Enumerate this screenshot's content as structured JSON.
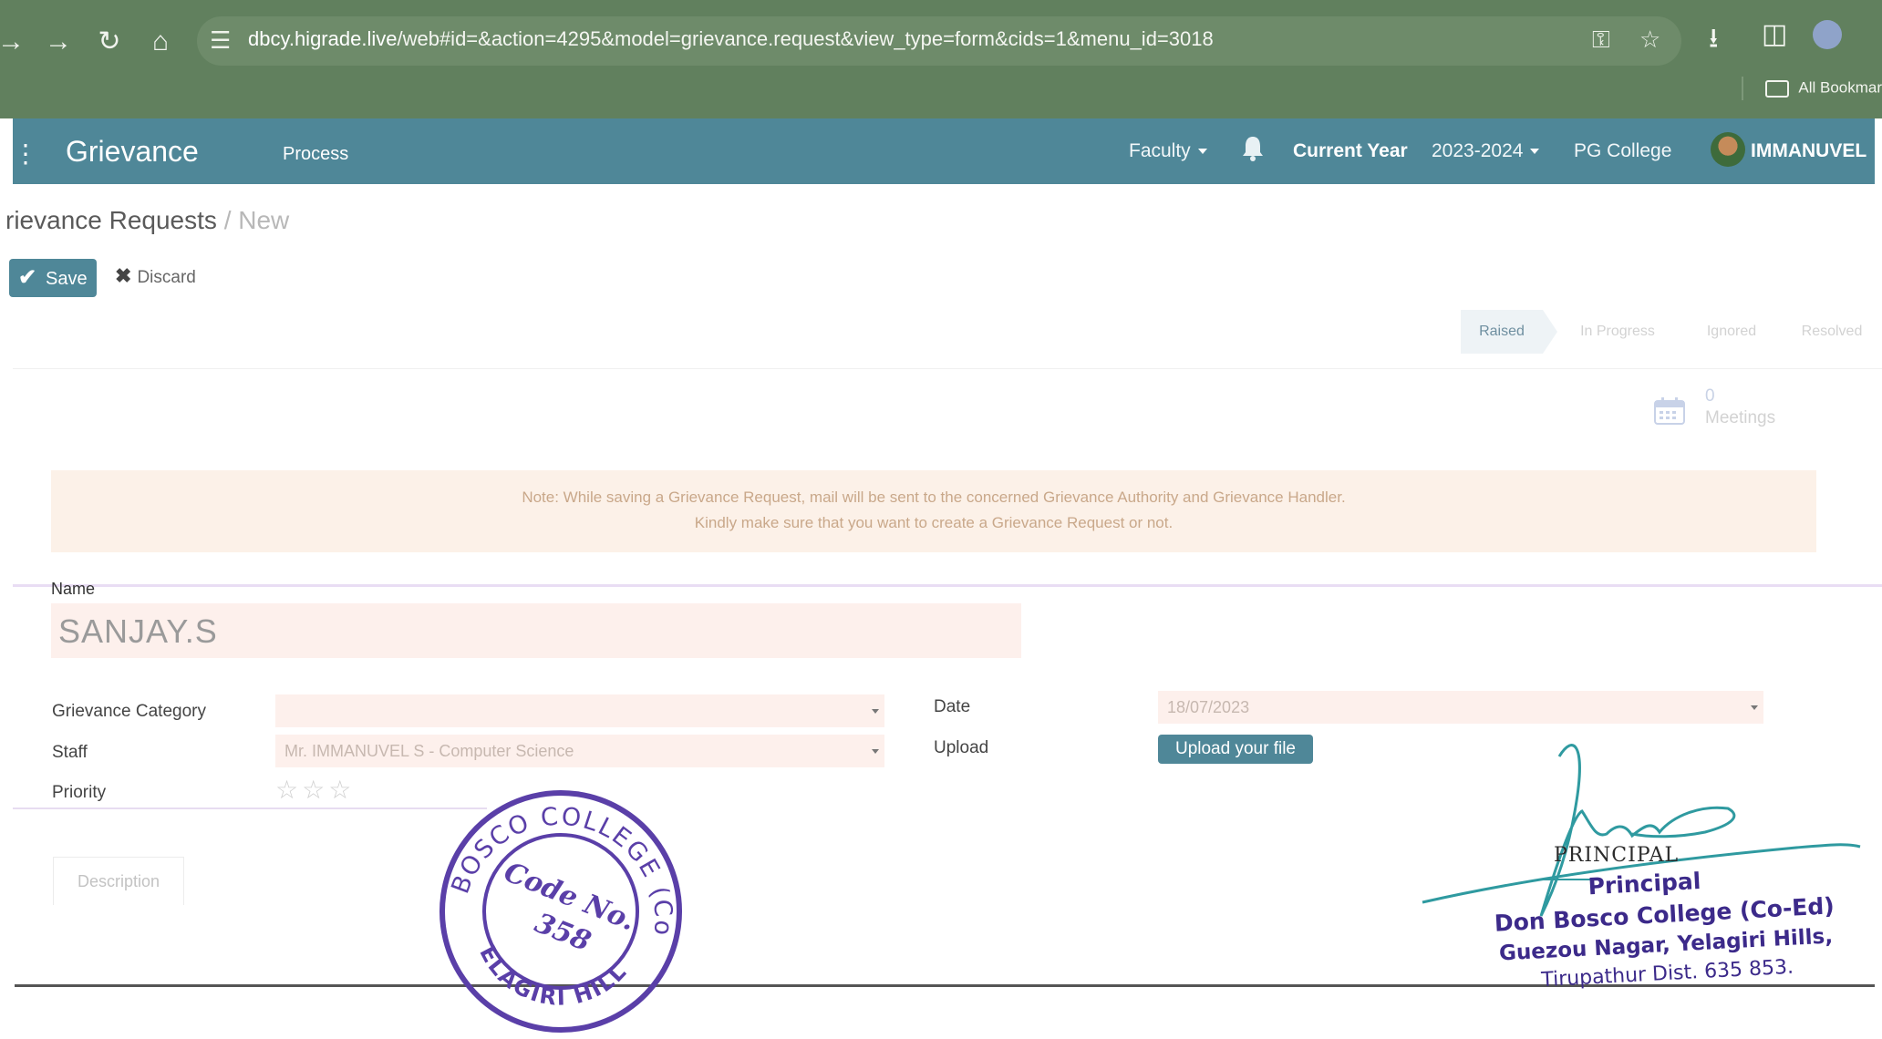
{
  "browser": {
    "url_domain": "dbcy.higrade.live",
    "url_rest": "/web#id=&action=4295&model=grievance.request&view_type=form&cids=1&menu_id=3018",
    "bookmarks_label": "All Bookmar"
  },
  "navbar": {
    "brand": "Grievance",
    "menu_process": "Process",
    "faculty": "Faculty",
    "current_year_label": "Current Year",
    "year": "2023-2024",
    "college": "PG College",
    "user": "IMMANUVEL"
  },
  "breadcrumb": {
    "parent": "rievance Requests",
    "separator": "/",
    "current": "New"
  },
  "actions": {
    "save": "Save",
    "discard": "Discard"
  },
  "status_stages": [
    {
      "label": "Raised",
      "active": true
    },
    {
      "label": "In Progress",
      "active": false
    },
    {
      "label": "Ignored",
      "active": false
    },
    {
      "label": "Resolved",
      "active": false
    }
  ],
  "meetings": {
    "count": "0",
    "label": "Meetings"
  },
  "note": {
    "line1": "Note: While saving a Grievance Request, mail will be sent to the concerned Grievance Authority and Grievance Handler.",
    "line2": "Kindly make sure that you want to create a Grievance Request or not."
  },
  "form": {
    "name_label": "Name",
    "name_value": "SANJAY.S",
    "category_label": "Grievance Category",
    "category_value": "",
    "staff_label": "Staff",
    "staff_value": "Mr. IMMANUVEL S - Computer Science",
    "priority_label": "Priority",
    "priority_stars": "☆☆☆",
    "date_label": "Date",
    "date_value": "18/07/2023",
    "upload_label": "Upload",
    "upload_button": "Upload your file"
  },
  "tabs": {
    "description": "Description"
  },
  "stamp": {
    "ring_text": "DON BOSCO COLLEGE (Co-Ed)",
    "bottom_text": "YELAGIRI HILLS",
    "center_line1": "Code No.",
    "center_line2": "358"
  },
  "signature_block": {
    "principal_caps": "PRINCIPAL",
    "title": "Principal",
    "college": "Don Bosco College (Co-Ed)",
    "address1": "Guezou Nagar, Yelagiri Hills,",
    "address2": "Tirupathur Dist. 635 853."
  },
  "colors": {
    "chrome_green": "#61805e",
    "navbar_teal": "#4f8798",
    "note_bg": "#fcf1e8",
    "stamp_purple": "#5a3fa8",
    "signature_teal": "#2f9aa0"
  }
}
